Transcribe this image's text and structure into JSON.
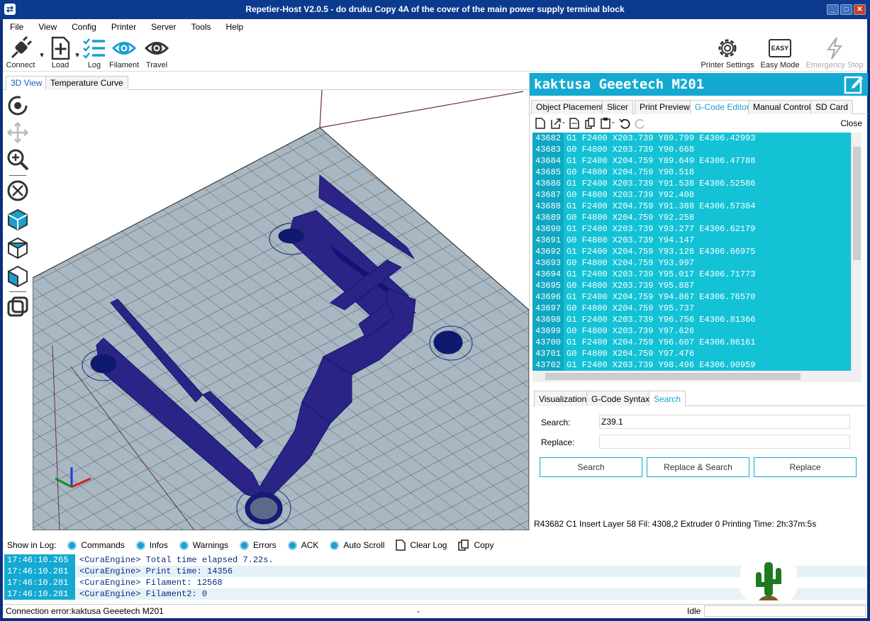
{
  "window": {
    "title": "Repetier-Host V2.0.5 - do druku Copy 4A of the cover of the main power supply terminal block",
    "min": "_",
    "max": "□",
    "close": "✕"
  },
  "menu": [
    "File",
    "View",
    "Config",
    "Printer",
    "Server",
    "Tools",
    "Help"
  ],
  "toolbar": {
    "connect": "Connect",
    "load": "Load",
    "log": "Log",
    "filament": "Filament",
    "travel": "Travel",
    "printer_settings": "Printer Settings",
    "easy_mode": "Easy Mode",
    "easy_badge": "EASY",
    "emergency_stop": "Emergency Stop"
  },
  "view_tabs": [
    "3D View",
    "Temperature Curve"
  ],
  "printer_name": "kaktusa Geeetech M201",
  "panel_tabs": [
    "Object Placement",
    "Slicer",
    "Print Preview",
    "G-Code Editor",
    "Manual Control",
    "SD Card"
  ],
  "editor": {
    "close": "Close"
  },
  "gcode_lines": [
    {
      "n": "43682",
      "c": "G1 F2400 X203.739 Y89.799 E4306.42993"
    },
    {
      "n": "43683",
      "c": "G0 F4800 X203.739 Y90.668"
    },
    {
      "n": "43684",
      "c": "G1 F2400 X204.759 Y89.649 E4306.47788"
    },
    {
      "n": "43685",
      "c": "G0 F4800 X204.759 Y90.518"
    },
    {
      "n": "43686",
      "c": "G1 F2400 X203.739 Y91.538 E4306.52586"
    },
    {
      "n": "43687",
      "c": "G0 F4800 X203.739 Y92.408"
    },
    {
      "n": "43688",
      "c": "G1 F2400 X204.759 Y91.388 E4306.57384"
    },
    {
      "n": "43689",
      "c": "G0 F4800 X204.759 Y92.258"
    },
    {
      "n": "43690",
      "c": "G1 F2400 X203.739 Y93.277 E4306.62179"
    },
    {
      "n": "43691",
      "c": "G0 F4800 X203.739 Y94.147"
    },
    {
      "n": "43692",
      "c": "G1 F2400 X204.759 Y93.128 E4306.66975"
    },
    {
      "n": "43693",
      "c": "G0 F4800 X204.759 Y93.997"
    },
    {
      "n": "43694",
      "c": "G1 F2400 X203.739 Y95.017 E4306.71773"
    },
    {
      "n": "43695",
      "c": "G0 F4800 X203.739 Y95.887"
    },
    {
      "n": "43696",
      "c": "G1 F2400 X204.759 Y94.867 E4306.76570"
    },
    {
      "n": "43697",
      "c": "G0 F4800 X204.759 Y95.737"
    },
    {
      "n": "43698",
      "c": "G1 F2400 X203.739 Y96.756 E4306.81366"
    },
    {
      "n": "43699",
      "c": "G0 F4800 X203.739 Y97.626"
    },
    {
      "n": "43700",
      "c": "G1 F2400 X204.759 Y96.607 E4306.86161"
    },
    {
      "n": "43701",
      "c": "G0 F4800 X204.759 Y97.476"
    },
    {
      "n": "43702",
      "c": "G1 F2400 X203.739 Y98.496 E4306.90959"
    }
  ],
  "sub_tabs": [
    "Visualization",
    "G-Code Syntax",
    "Search"
  ],
  "search": {
    "search_label": "Search:",
    "search_value": "Z39.1",
    "replace_label": "Replace:",
    "replace_value": "",
    "btn_search": "Search",
    "btn_replace_search": "Replace & Search",
    "btn_replace": "Replace"
  },
  "editor_status": "R43682   C1   Insert   Layer 58 Fil: 4308,2   Extruder 0   Printing Time: 2h:37m:5s",
  "log": {
    "show": "Show in Log:",
    "commands": "Commands",
    "infos": "Infos",
    "warnings": "Warnings",
    "errors": "Errors",
    "ack": "ACK",
    "autoscroll": "Auto Scroll",
    "clear": "Clear Log",
    "copy": "Copy"
  },
  "log_lines": [
    {
      "t": "17:46:10.265",
      "m": "<CuraEngine> Total time elapsed  7.22s."
    },
    {
      "t": "17:46:10.281",
      "m": "<CuraEngine> Print time: 14356"
    },
    {
      "t": "17:46:10.281",
      "m": "<CuraEngine> Filament: 12568"
    },
    {
      "t": "17:46:10.281",
      "m": "<CuraEngine> Filament2: 0"
    }
  ],
  "status": {
    "conn": "Connection error:kaktusa Geeetech M201",
    "dash": "-",
    "idle": "Idle"
  },
  "colors": {
    "accent": "#14a9d0",
    "plate": "#a8b7c1",
    "model": "#2b2385"
  }
}
